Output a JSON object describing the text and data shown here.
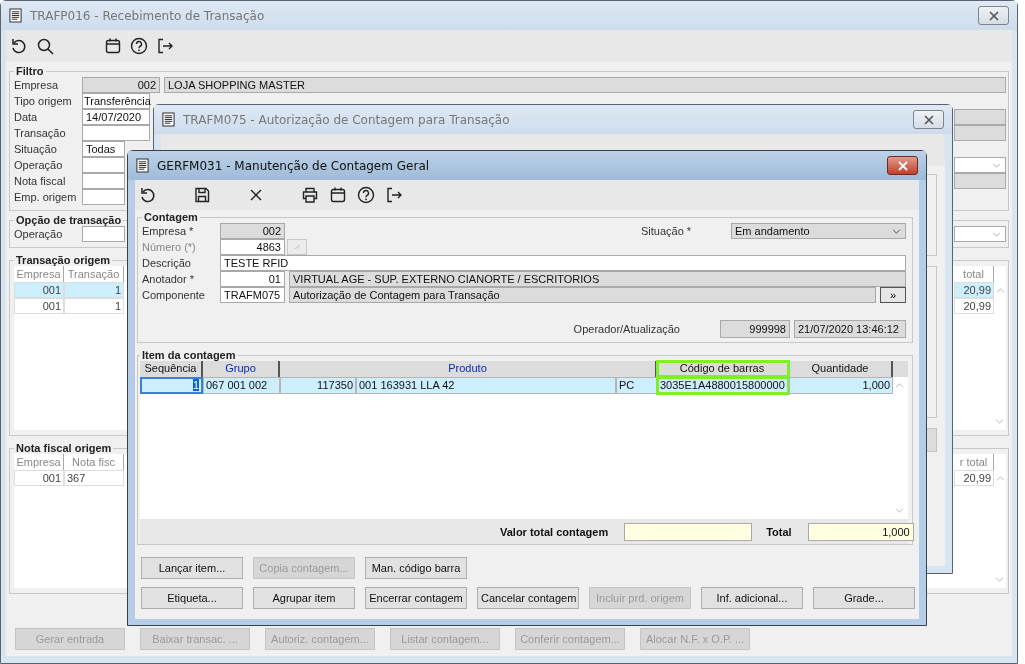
{
  "main_window": {
    "title": "TRAFP016 - Recebimento de Transação",
    "filter": {
      "legend": "Filtro",
      "fields": [
        {
          "label": "Empresa",
          "kind": "code-name",
          "code": "002",
          "name": "LOJA SHOPPING MASTER"
        },
        {
          "label": "Tipo origem",
          "kind": "select",
          "value": "Transferência"
        },
        {
          "label": "Data",
          "kind": "text",
          "value": "14/07/2020"
        },
        {
          "label": "Transação",
          "kind": "text"
        },
        {
          "label": "Situação",
          "kind": "text",
          "value": "Todas"
        },
        {
          "label": "Operação",
          "kind": "text"
        },
        {
          "label": "Nota fiscal",
          "kind": "text"
        },
        {
          "label": "Emp. origem",
          "kind": "text"
        }
      ]
    },
    "option": {
      "legend": "Opção de transação",
      "fields": [
        {
          "label": "Operação",
          "kind": "select"
        }
      ]
    },
    "origin_transactions": {
      "legend": "Transação origem",
      "columns": [
        "Empresa",
        "Transação",
        "total"
      ],
      "rows": [
        {
          "selected": true,
          "cells": [
            "001",
            "1",
            "20,99"
          ]
        },
        {
          "selected": false,
          "cells": [
            "001",
            "1",
            "20,99"
          ]
        }
      ]
    },
    "origin_invoices": {
      "legend": "Nota fiscal origem",
      "columns": [
        "Empresa",
        "Nota fisc",
        "r total"
      ],
      "rows": [
        {
          "selected": false,
          "cells": [
            "001",
            "367",
            "20,99"
          ]
        }
      ]
    },
    "buttons": [
      {
        "label": "Gerar entrada",
        "disabled": true
      },
      {
        "label": "Baixar transac. ...",
        "disabled": true
      },
      {
        "label": "Autoriz. contagem...",
        "disabled": true
      },
      {
        "label": "Listar contagem...",
        "disabled": true
      },
      {
        "label": "Conferir contagem...",
        "disabled": true
      },
      {
        "label": "Alocar N.F. x O.P. ...",
        "disabled": true
      }
    ]
  },
  "auth_window": {
    "title": "TRAFM075 - Autorização de Contagem para Transação"
  },
  "count_window": {
    "title": "GERFM031 - Manutenção de Contagem Geral",
    "header": {
      "legend": "Contagem",
      "company": {
        "label": "Empresa *",
        "value": "002"
      },
      "status": {
        "label": "Situação *",
        "value": "Em andamento"
      },
      "number": {
        "label": "Número (*)",
        "value": "4863",
        "disabled": true
      },
      "description": {
        "label": "Descrição",
        "value": "TESTE RFID"
      },
      "annotator": {
        "label": "Anotador *",
        "code": "01",
        "name": "VIRTUAL AGE - SUP. EXTERNO CIANORTE / ESCRITORIOS"
      },
      "component": {
        "label": "Componente",
        "code": "TRAFM075",
        "name": "Autorização de Contagem para Transação",
        "button": "»"
      },
      "operator": {
        "label": "Operador/Atualização",
        "code": "999998",
        "timestamp": "21/07/2020 13:46:12"
      }
    },
    "items": {
      "legend": "Item da contagem",
      "columns": [
        {
          "label": "Sequência",
          "kind": "plain",
          "highlighted": false
        },
        {
          "label": "Grupo",
          "kind": "lookup",
          "highlighted": false
        },
        {
          "label": "Produto",
          "kind": "lookup",
          "highlighted": false
        },
        {
          "label": "Código de barras",
          "kind": "plain",
          "highlighted": true
        },
        {
          "label": "Quantidade",
          "kind": "plain",
          "highlighted": false
        }
      ],
      "rows": [
        {
          "selected": true,
          "cells": [
            [
              "1"
            ],
            [
              "067 001 002"
            ],
            [
              "117350",
              "001 163931 LLA 42",
              "PC"
            ],
            [
              "3035E1A4880015800000"
            ],
            [
              "1,000"
            ]
          ]
        }
      ],
      "totals": [
        {
          "label": "Valor total contagem"
        },
        {
          "label": "Total",
          "value": "1,000"
        }
      ]
    },
    "buttons": [
      [
        {
          "label": "Lançar item...",
          "disabled": false
        },
        {
          "label": "Copia contagem...",
          "disabled": true
        },
        {
          "label": "Man. código barra",
          "disabled": false
        }
      ],
      [
        {
          "label": "Etiqueta...",
          "disabled": false
        },
        {
          "label": "Agrupar item",
          "disabled": false
        },
        {
          "label": "Encerrar contagem",
          "disabled": false
        },
        {
          "label": "Cancelar contagem",
          "disabled": false
        },
        {
          "label": "Incluir prd. origem",
          "disabled": true
        },
        {
          "label": "Inf. adicional...",
          "disabled": false
        },
        {
          "label": "Grade...",
          "disabled": false
        }
      ]
    ]
  }
}
